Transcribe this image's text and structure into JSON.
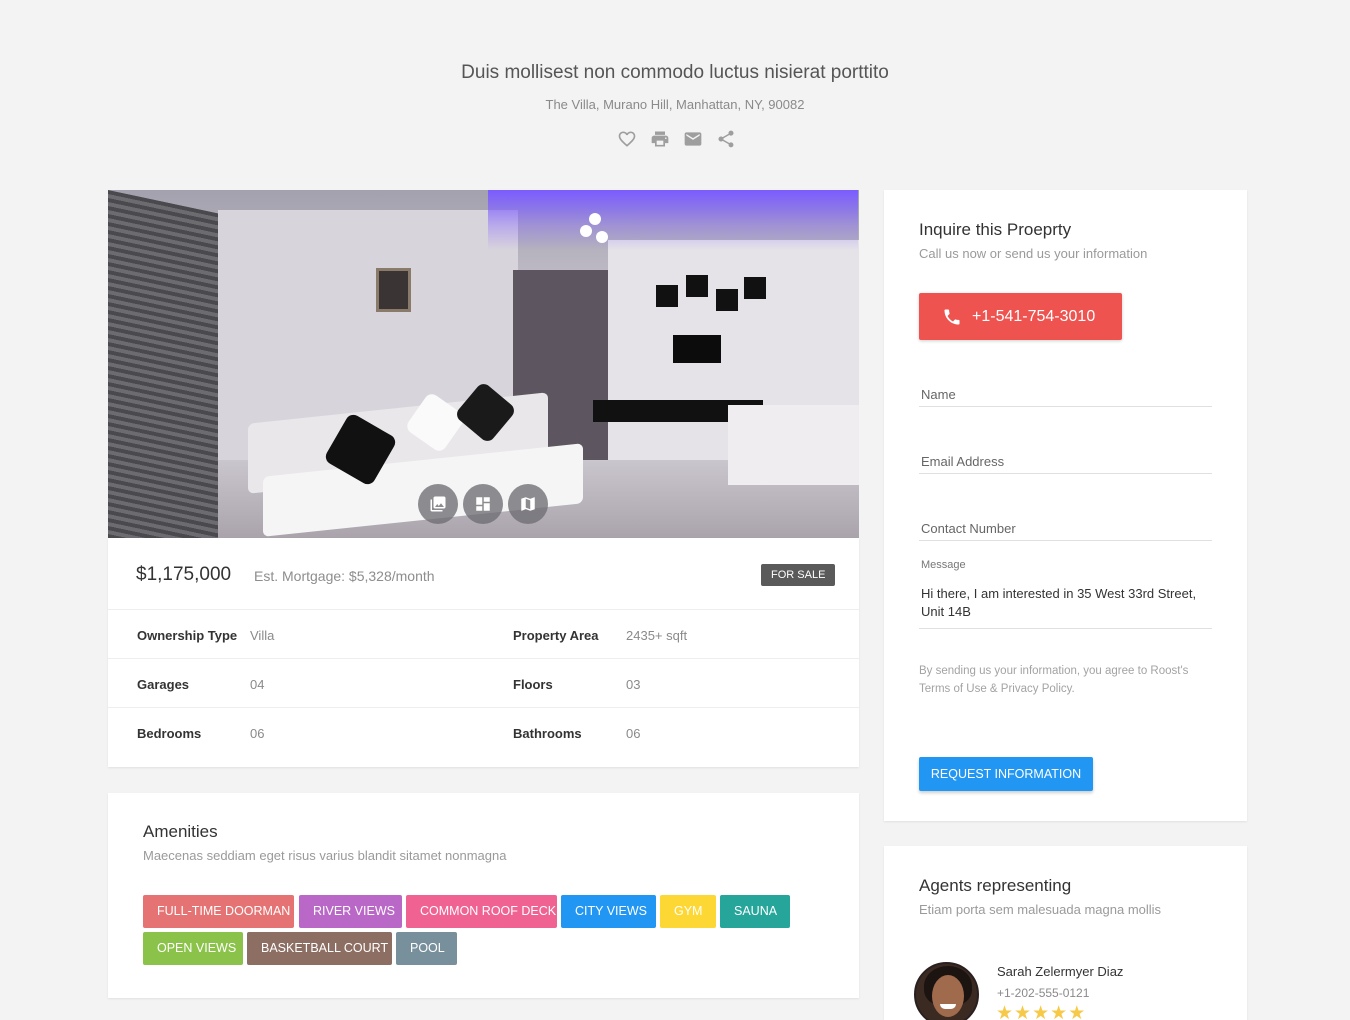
{
  "header": {
    "title": "Duis mollisest non commodo luctus nisierat porttito",
    "address": "The Villa, Murano Hill, Manhattan, NY, 90082",
    "actions": [
      "heart-icon",
      "print-icon",
      "mail-icon",
      "share-icon"
    ]
  },
  "gallery": {
    "controls": [
      "photo-library-icon",
      "dashboard-icon",
      "map-icon"
    ]
  },
  "listing": {
    "price": "$1,175,000",
    "mortgage": "Est. Mortgage: $5,328/month",
    "status": "FOR SALE",
    "properties": [
      {
        "label": "Ownership Type",
        "value": "Villa",
        "label2": "Property Area",
        "value2": "2435+ sqft"
      },
      {
        "label": "Garages",
        "value": "04",
        "label2": "Floors",
        "value2": "03"
      },
      {
        "label": "Bedrooms",
        "value": "06",
        "label2": "Bathrooms",
        "value2": "06"
      }
    ]
  },
  "amenities": {
    "title": "Amenities",
    "subtitle": "Maecenas seddiam eget risus varius blandit sitamet nonmagna",
    "tags": [
      {
        "label": "FULL-TIME DOORMAN",
        "color": "#e57373"
      },
      {
        "label": "RIVER VIEWS",
        "color": "#ba68c8"
      },
      {
        "label": "COMMON ROOF DECK",
        "color": "#f06292"
      },
      {
        "label": "CITY VIEWS",
        "color": "#2196f3"
      },
      {
        "label": "GYM",
        "color": "#fdd835"
      },
      {
        "label": "SAUNA",
        "color": "#26a69a"
      },
      {
        "label": "OPEN VIEWS",
        "color": "#8bc34a"
      },
      {
        "label": "BASKETBALL COURT",
        "color": "#8d6e63"
      },
      {
        "label": "POOL",
        "color": "#78909c"
      }
    ]
  },
  "inquire": {
    "title": "Inquire this Proeprty",
    "subtitle": "Call us now or send us your information",
    "phone": "+1-541-754-3010",
    "name_placeholder": "Name",
    "email_placeholder": "Email Address",
    "contact_placeholder": "Contact Number",
    "message_label": "Message",
    "message_text": "Hi there, I am interested in 35 West 33rd Street, Unit 14B",
    "terms": "By sending us your information, you agree to Roost's Terms of Use & Privacy Policy.",
    "submit_label": "REQUEST INFORMATION",
    "accent_color": "#ef5350",
    "button_color": "#2196f3"
  },
  "agents": {
    "title": "Agents representing",
    "subtitle": "Etiam porta sem malesuada magna mollis",
    "list": [
      {
        "name": "Sarah Zelermyer Diaz",
        "phone": "+1-202-555-0121",
        "rating": 5
      }
    ]
  }
}
